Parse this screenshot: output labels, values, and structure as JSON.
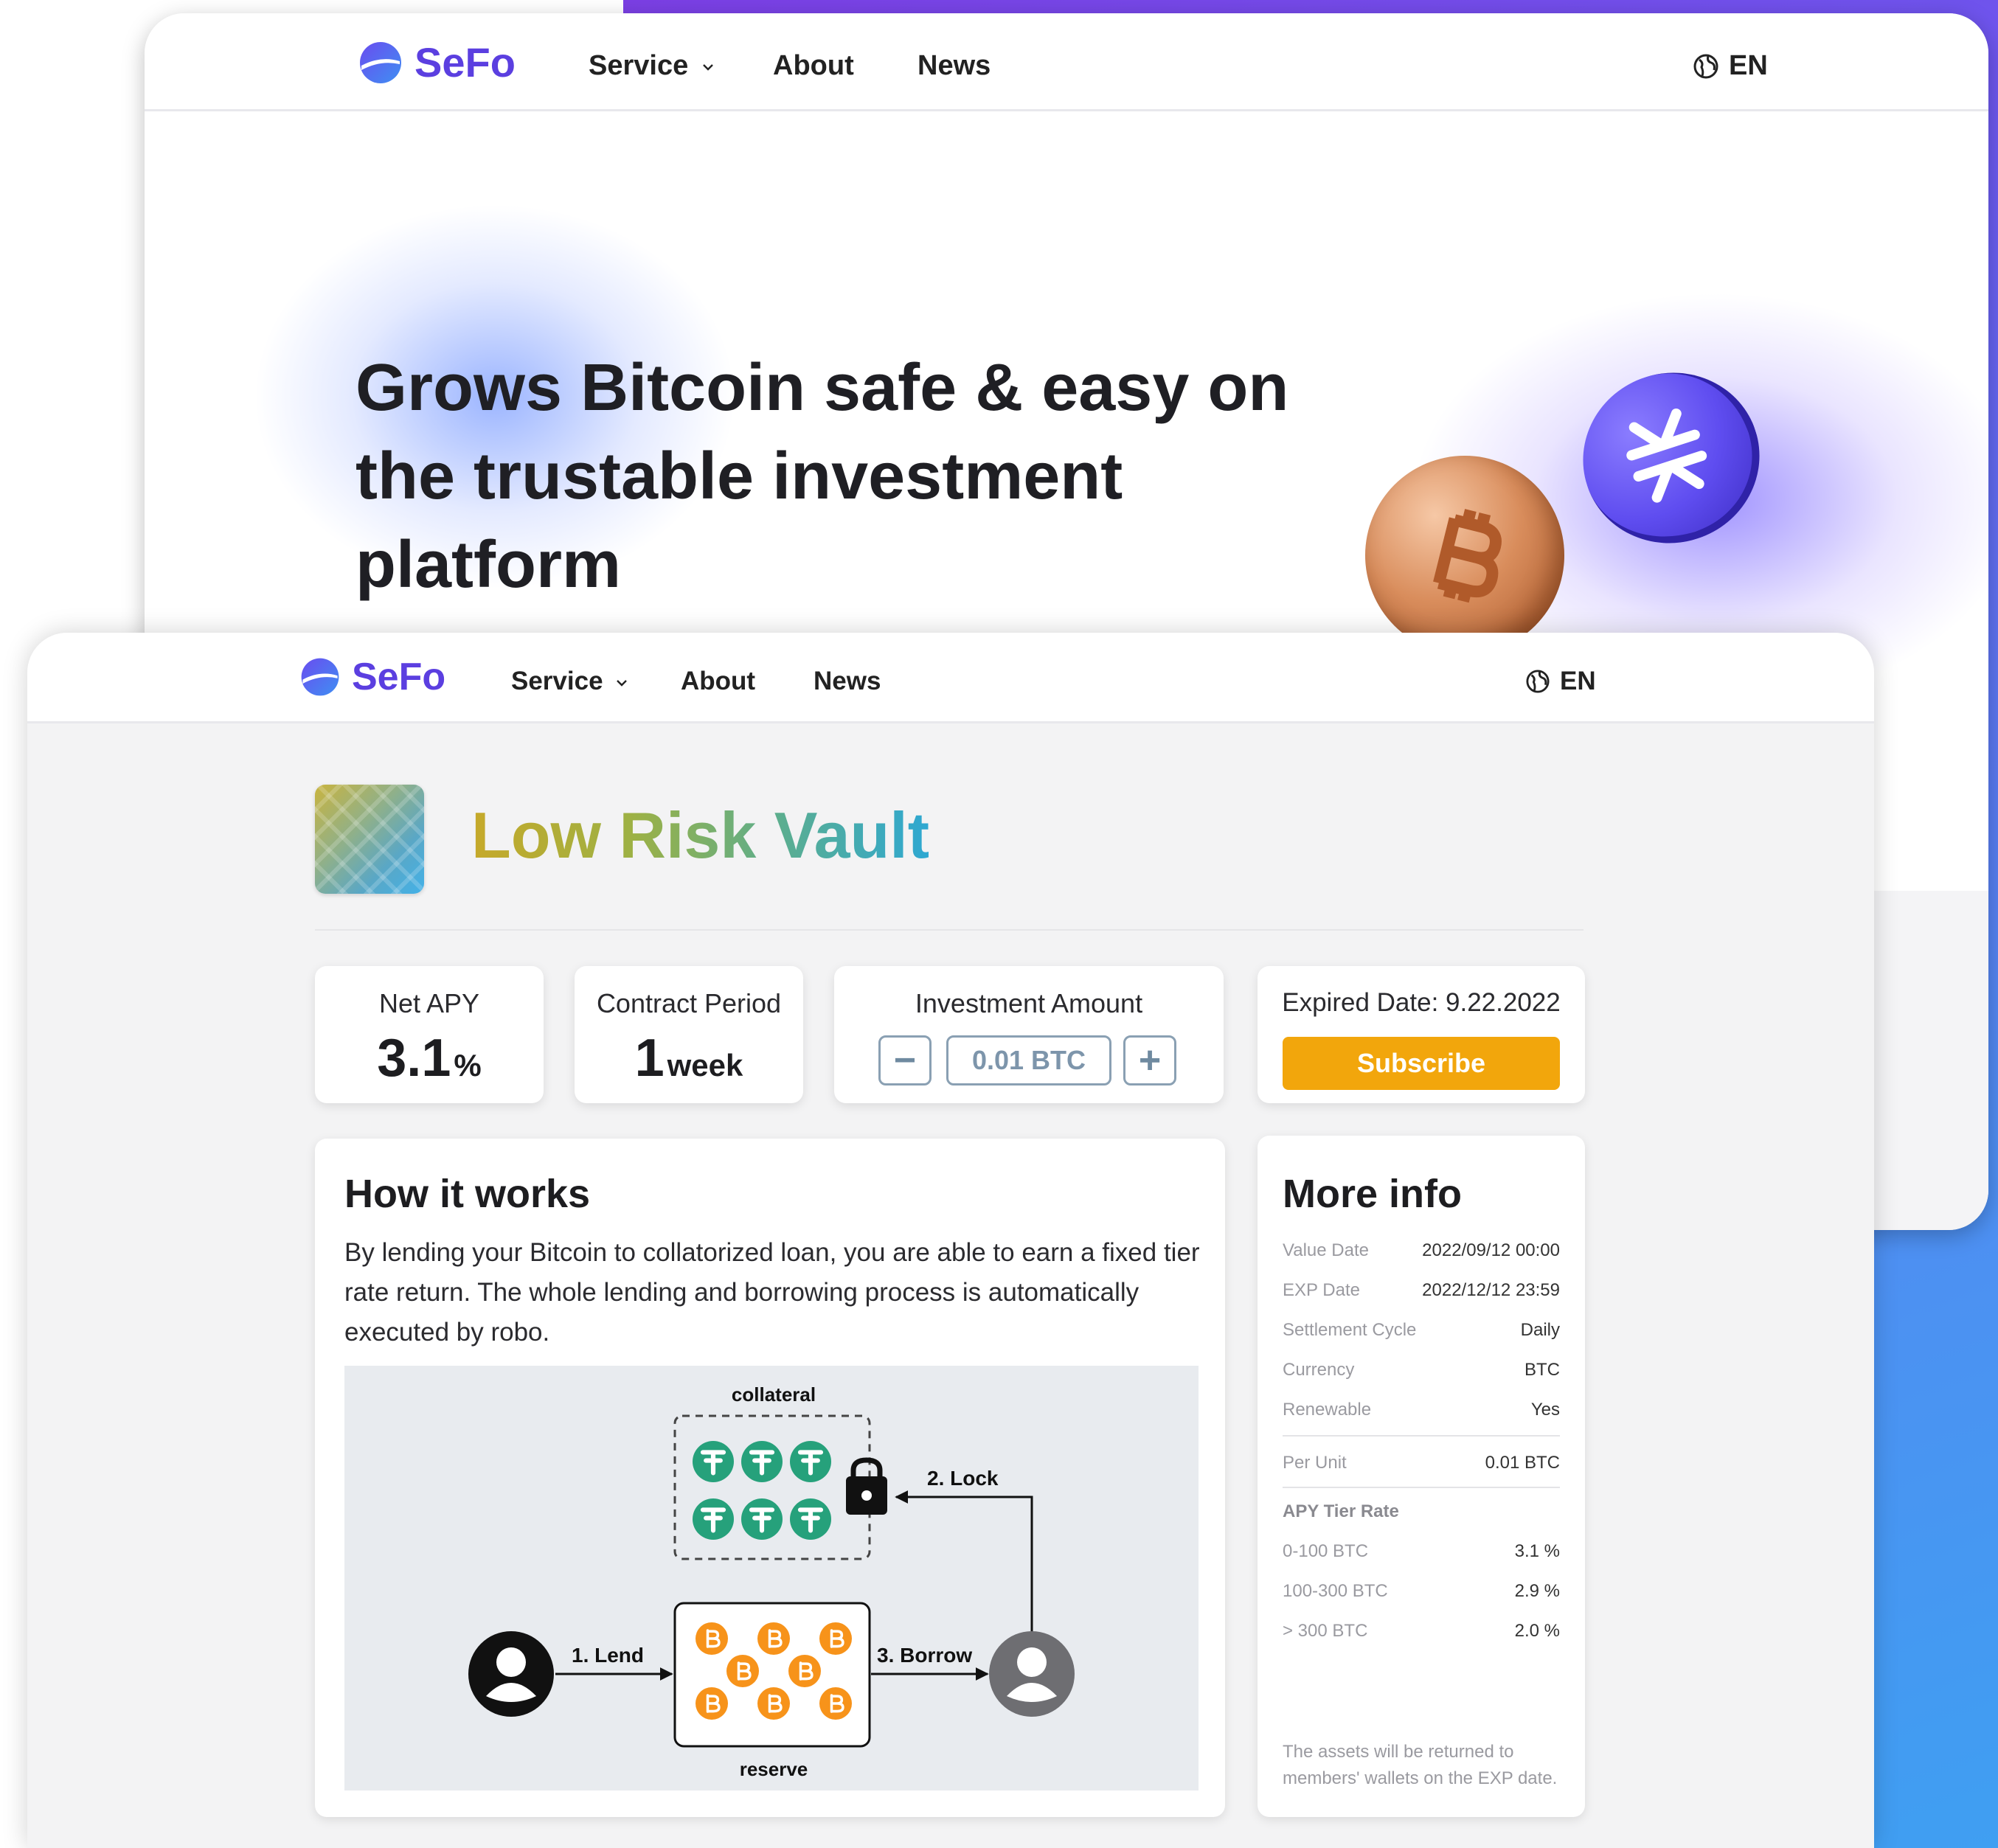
{
  "brand": {
    "name": "SeFo",
    "color": "#5b3fe0"
  },
  "nav": {
    "items": [
      {
        "label": "Service"
      },
      {
        "label": "About"
      },
      {
        "label": "News"
      }
    ],
    "language": "EN"
  },
  "hero": {
    "title": "Grows Bitcoin safe & easy on the trustable investment platform"
  },
  "vault": {
    "title": "Low Risk Vault"
  },
  "stats": {
    "net_apy": {
      "label": "Net APY",
      "value": "3.1",
      "unit": "%"
    },
    "contract_period": {
      "label": "Contract Period",
      "value": "1",
      "unit": "week"
    },
    "investment": {
      "label": "Investment Amount",
      "value": "0.01 BTC",
      "minus": "−",
      "plus": "+"
    },
    "expiry": {
      "label": "Expired Date: 9.22.2022",
      "subscribe": "Subscribe",
      "accent": "#f2a60c"
    }
  },
  "how_it_works": {
    "title": "How it works",
    "text": "By lending your Bitcoin to collatorized loan, you are able to earn a fixed tier rate return. The whole lending and borrowing process is automatically executed by robo.",
    "diagram": {
      "collateral": "collateral",
      "reserve": "reserve",
      "lend": "1. Lend",
      "lock": "2. Lock",
      "borrow": "3. Borrow",
      "tether_color": "#26a17b",
      "btc_color": "#f7931a"
    }
  },
  "more_info": {
    "title": "More info",
    "rows": [
      {
        "k": "Value Date",
        "v": "2022/09/12 00:00"
      },
      {
        "k": "EXP Date",
        "v": "2022/12/12 23:59"
      },
      {
        "k": "Settlement Cycle",
        "v": "Daily"
      },
      {
        "k": "Currency",
        "v": "BTC"
      },
      {
        "k": "Renewable",
        "v": "Yes"
      }
    ],
    "per_unit": {
      "k": "Per Unit",
      "v": "0.01 BTC"
    },
    "apy_heading": "APY Tier Rate",
    "tiers": [
      {
        "k": "0-100 BTC",
        "v": "3.1 %"
      },
      {
        "k": "100-300 BTC",
        "v": "2.9 %"
      },
      {
        "k": "> 300 BTC",
        "v": "2.0 %"
      }
    ],
    "note": "The assets will be returned to members' wallets on the EXP date."
  }
}
